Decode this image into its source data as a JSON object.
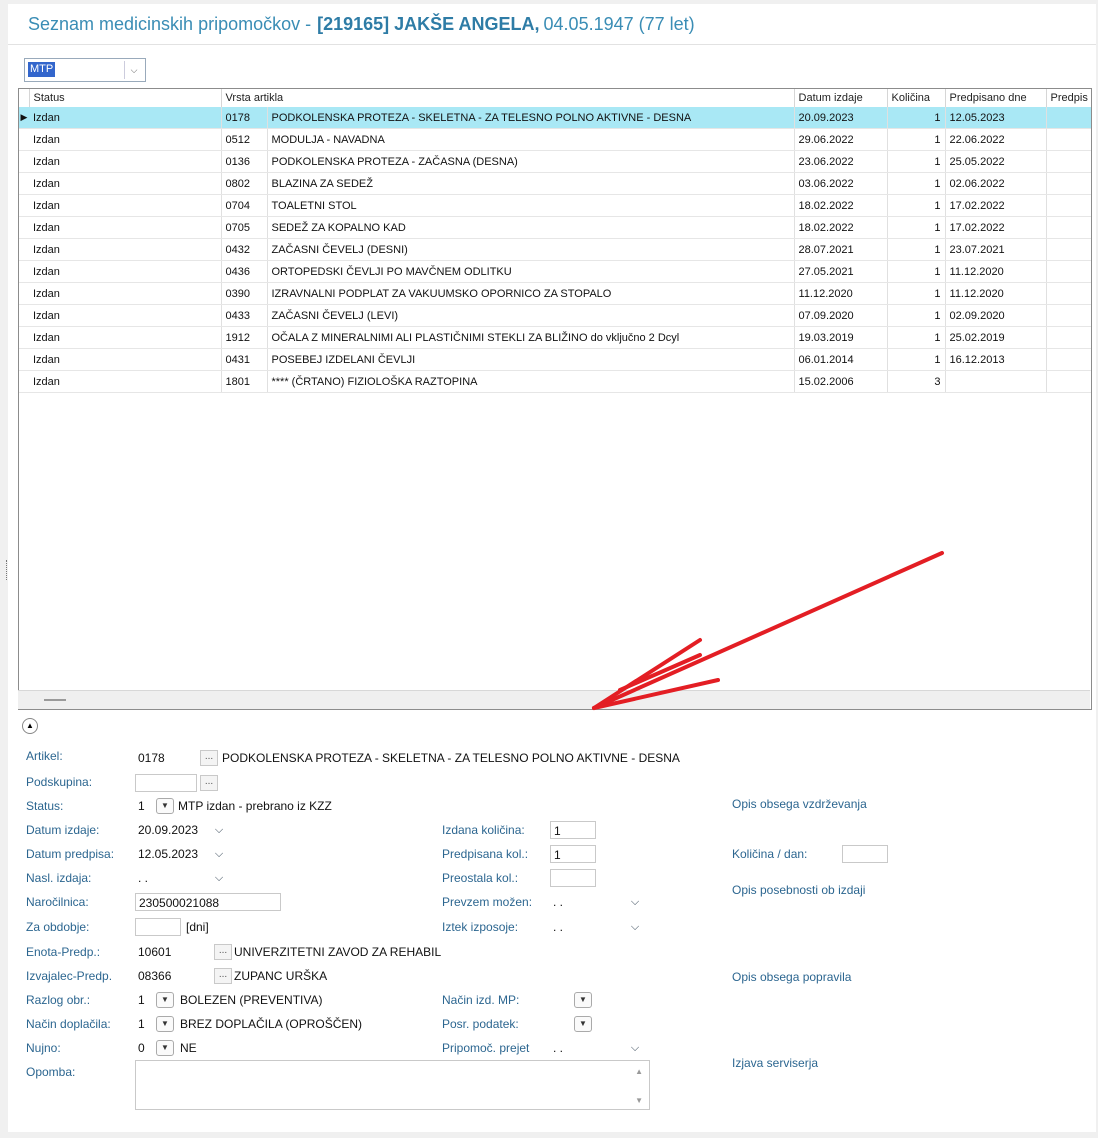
{
  "header": {
    "title": "Seznam medicinskih pripomočkov -",
    "patient": "[219165] JAKŠE ANGELA,",
    "dob": "04.05.1947 (77 let)"
  },
  "filter": {
    "value": "MTP"
  },
  "grid": {
    "columns": [
      "Status",
      "Vrsta artikla",
      "",
      "Datum izdaje",
      "Količina",
      "Predpisano dne",
      "Predpis"
    ],
    "rows": [
      {
        "status": "Izdan",
        "code": "0178",
        "name": "PODKOLENSKA PROTEZA - SKELETNA - ZA TELESNO POLNO AKTIVNE - DESNA",
        "date": "20.09.2023",
        "qty": "1",
        "presc": "12.05.2023"
      },
      {
        "status": "Izdan",
        "code": "0512",
        "name": "MODULJA - NAVADNA",
        "date": "29.06.2022",
        "qty": "1",
        "presc": "22.06.2022"
      },
      {
        "status": "Izdan",
        "code": "0136",
        "name": "PODKOLENSKA PROTEZA - ZAČASNA (DESNA)",
        "date": "23.06.2022",
        "qty": "1",
        "presc": "25.05.2022"
      },
      {
        "status": "Izdan",
        "code": "0802",
        "name": "BLAZINA ZA SEDEŽ",
        "date": "03.06.2022",
        "qty": "1",
        "presc": "02.06.2022"
      },
      {
        "status": "Izdan",
        "code": "0704",
        "name": "TOALETNI STOL",
        "date": "18.02.2022",
        "qty": "1",
        "presc": "17.02.2022"
      },
      {
        "status": "Izdan",
        "code": "0705",
        "name": "SEDEŽ ZA KOPALNO KAD",
        "date": "18.02.2022",
        "qty": "1",
        "presc": "17.02.2022"
      },
      {
        "status": "Izdan",
        "code": "0432",
        "name": "ZAČASNI ČEVELJ (DESNI)",
        "date": "28.07.2021",
        "qty": "1",
        "presc": "23.07.2021"
      },
      {
        "status": "Izdan",
        "code": "0436",
        "name": "ORTOPEDSKI ČEVLJI PO MAVČNEM ODLITKU",
        "date": "27.05.2021",
        "qty": "1",
        "presc": "11.12.2020"
      },
      {
        "status": "Izdan",
        "code": "0390",
        "name": "IZRAVNALNI PODPLAT ZA VAKUUMSKO OPORNICO ZA STOPALO",
        "date": "11.12.2020",
        "qty": "1",
        "presc": "11.12.2020"
      },
      {
        "status": "Izdan",
        "code": "0433",
        "name": "ZAČASNI ČEVELJ (LEVI)",
        "date": "07.09.2020",
        "qty": "1",
        "presc": "02.09.2020"
      },
      {
        "status": "Izdan",
        "code": "1912",
        "name": "OČALA Z MINERALNIMI ALI PLASTIČNIMI STEKLI ZA BLIŽINO do vključno 2 Dcyl",
        "date": "19.03.2019",
        "qty": "1",
        "presc": "25.02.2019"
      },
      {
        "status": "Izdan",
        "code": "0431",
        "name": "POSEBEJ IZDELANI ČEVLJI",
        "date": "06.01.2014",
        "qty": "1",
        "presc": "16.12.2013"
      },
      {
        "status": "Izdan",
        "code": "1801",
        "name": "**** (ČRTANO) FIZIOLOŠKA RAZTOPINA",
        "date": "15.02.2006",
        "qty": "3",
        "presc": ""
      }
    ]
  },
  "form": {
    "artikel_label": "Artikel:",
    "artikel_code": "0178",
    "artikel_name": "PODKOLENSKA PROTEZA - SKELETNA - ZA TELESNO POLNO AKTIVNE - DESNA",
    "podskupina_label": "Podskupina:",
    "podskupina_value": "",
    "status_label": "Status:",
    "status_code": "1",
    "status_text": "MTP izdan - prebrano iz KZZ",
    "datum_izdaje_label": "Datum izdaje:",
    "datum_izdaje": "20.09.2023",
    "datum_predpisa_label": "Datum predpisa:",
    "datum_predpisa": "12.05.2023",
    "nasl_izdaja_label": "Nasl. izdaja:",
    "nasl_izdaja": " . .",
    "narocilnica_label": "Naročilnica:",
    "narocilnica": "230500021088",
    "za_obdobje_label": "Za obdobje:",
    "za_obdobje": "",
    "dni": "[dni]",
    "enota_label": "Enota-Predp.:",
    "enota_code": "10601",
    "enota_name": "UNIVERZITETNI ZAVOD ZA REHABIL",
    "izvajalec_label": "Izvajalec-Predp.",
    "izvajalec_code": "08366",
    "izvajalec_name": "ZUPANC URŠKA",
    "razlog_label": "Razlog obr.:",
    "razlog_code": "1",
    "razlog_text": "BOLEZEN (PREVENTIVA)",
    "doplacila_label": "Način doplačila:",
    "doplacila_code": "1",
    "doplacila_text": "BREZ DOPLAČILA (OPROŠČEN)",
    "nujno_label": "Nujno:",
    "nujno_code": "0",
    "nujno_text": "NE",
    "opomba_label": "Opomba:",
    "izdana_kol_label": "Izdana količina:",
    "izdana_kol": "1",
    "predpisana_kol_label": "Predpisana kol.:",
    "predpisana_kol": "1",
    "preostala_kol_label": "Preostala kol.:",
    "preostala_kol": "",
    "prevzem_label": "Prevzem možen:",
    "prevzem": " . .",
    "iztek_label": "Iztek izposoje:",
    "iztek": " . .",
    "nacin_mp_label": "Način izd. MP:",
    "posr_label": "Posr. podatek:",
    "pripomoc_label": "Pripomoč. prejet",
    "pripomoc": " . .",
    "opis_vzdrz": "Opis obsega vzdrževanja",
    "kolicina_dan_label": "Količina / dan:",
    "opis_posebnosti": "Opis posebnosti ob izdaji",
    "opis_popravila": "Opis obsega popravila",
    "izjava": "Izjava serviserja"
  }
}
